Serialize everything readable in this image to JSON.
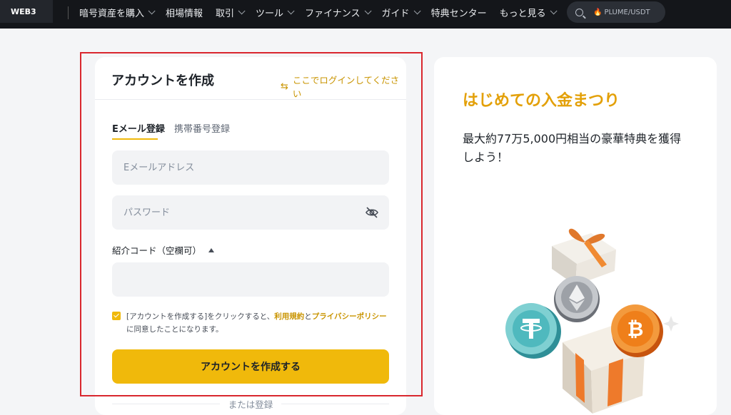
{
  "nav": {
    "web3_label": "WEB3",
    "items": [
      {
        "label": "暗号資産を購入",
        "has_dropdown": true
      },
      {
        "label": "相場情報",
        "has_dropdown": false
      },
      {
        "label": "取引",
        "has_dropdown": true
      },
      {
        "label": "ツール",
        "has_dropdown": true
      },
      {
        "label": "ファイナンス",
        "has_dropdown": true
      },
      {
        "label": "ガイド",
        "has_dropdown": true
      },
      {
        "label": "特典センター",
        "has_dropdown": false
      },
      {
        "label": "もっと見る",
        "has_dropdown": true
      }
    ],
    "search_pair": "PLUME/USDT",
    "search_icon": "search-icon",
    "pair_icon": "fire-icon"
  },
  "signup": {
    "title": "アカウントを作成",
    "login_link": "ここでログインしてください",
    "tabs": [
      {
        "label": "Eメール登録",
        "active": true
      },
      {
        "label": "携帯番号登録",
        "active": false
      }
    ],
    "email_placeholder": "Eメールアドレス",
    "password_placeholder": "パスワード",
    "referral_label": "紹介コード（空欄可）",
    "referral_value": "",
    "agree": {
      "checked": true,
      "prefix": "[アカウントを作成する]をクリックすると、",
      "terms_link": "利用規約",
      "and": "と",
      "privacy_link": "プライバシーポリシー",
      "suffix": "に同意したことになります。"
    },
    "submit_label": "アカウントを作成する",
    "or_label": "または登録"
  },
  "promo": {
    "title": "はじめての入金まつり",
    "description": "最大約77万5,000円相当の豪華特典を獲得しよう！"
  },
  "colors": {
    "accent": "#f0b90b",
    "link": "#c99400",
    "highlight_border": "#d9272e",
    "nav_bg": "#14161a"
  }
}
